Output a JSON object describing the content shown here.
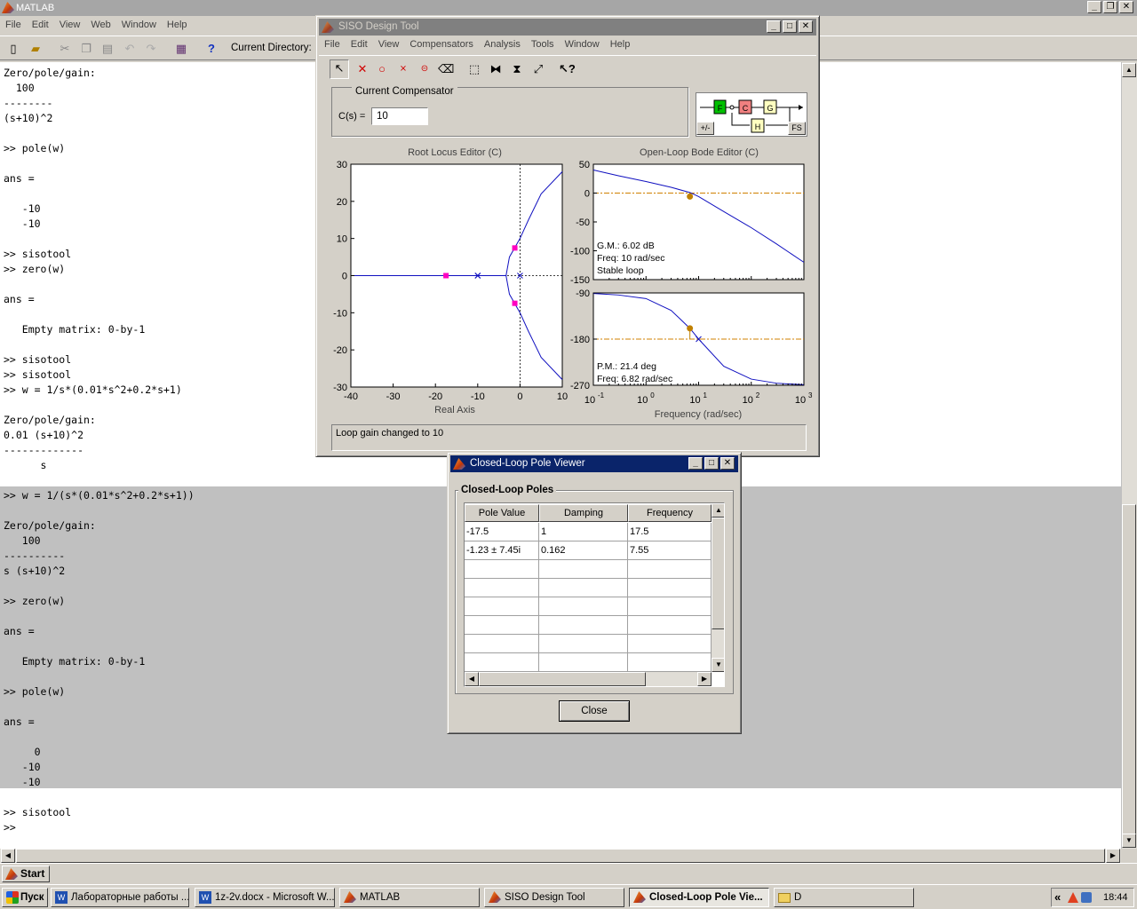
{
  "matlab": {
    "title": "MATLAB",
    "menu": [
      "File",
      "Edit",
      "View",
      "Web",
      "Window",
      "Help"
    ],
    "current_directory_label": "Current Directory:",
    "command_lines": [
      "Zero/pole/gain:",
      "  100",
      "--------",
      "(s+10)^2",
      "",
      ">> pole(w)",
      "",
      "ans =",
      "",
      "   -10",
      "   -10",
      "",
      ">> sisotool",
      ">> zero(w)",
      "",
      "ans =",
      "",
      "   Empty matrix: 0-by-1",
      "",
      ">> sisotool",
      ">> sisotool",
      ">> w = 1/s*(0.01*s^2+0.2*s+1)",
      "",
      "Zero/pole/gain:",
      "0.01 (s+10)^2",
      "-------------",
      "      s",
      "",
      ">> w = 1/(s*(0.01*s^2+0.2*s+1))",
      "",
      "Zero/pole/gain:",
      "   100",
      "----------",
      "s (s+10)^2",
      "",
      ">> zero(w)",
      "",
      "ans =",
      "",
      "   Empty matrix: 0-by-1",
      "",
      ">> pole(w)",
      "",
      "ans =",
      "",
      "     0",
      "   -10",
      "   -10",
      "",
      ">> sisotool",
      ">>"
    ]
  },
  "siso": {
    "title": "SISO Design Tool",
    "menu": [
      "File",
      "Edit",
      "View",
      "Compensators",
      "Analysis",
      "Tools",
      "Window",
      "Help"
    ],
    "compensator_legend": "Current Compensator",
    "cs_label": "C(s) =",
    "cs_value": "10",
    "diagram": {
      "f": "F",
      "c": "C",
      "g": "G",
      "h": "H",
      "pm": "+/-",
      "fs": "FS"
    },
    "root_locus_title": "Root Locus Editor (C)",
    "bode_title": "Open-Loop Bode Editor (C)",
    "rl_xlabel": "Real Axis",
    "bode_xlabel": "Frequency (rad/sec)",
    "gm_text": "G.M.: 6.02 dB",
    "gm_freq": "Freq: 10 rad/sec",
    "stable_text": "Stable loop",
    "pm_text": "P.M.: 21.4 deg",
    "pm_freq": "Freq: 6.82 rad/sec",
    "status": "Loop gain changed to 10"
  },
  "chart_data": [
    {
      "type": "line",
      "title": "Root Locus Editor (C)",
      "xlabel": "Real Axis",
      "ylabel": "",
      "xlim": [
        -40,
        10
      ],
      "ylim": [
        -30,
        30
      ],
      "xticks": [
        -40,
        -30,
        -20,
        -10,
        0,
        10
      ],
      "yticks": [
        30,
        20,
        10,
        0,
        -10,
        -20,
        -30
      ],
      "open_loop_poles": [
        [
          0,
          0
        ],
        [
          -10,
          0
        ],
        [
          -10,
          0
        ]
      ],
      "closed_loop_poles": [
        [
          -17.5,
          0
        ],
        [
          -1.23,
          7.45
        ],
        [
          -1.23,
          -7.45
        ]
      ],
      "branches": [
        {
          "x": [
            -40,
            -10
          ],
          "y": [
            0,
            0
          ]
        },
        {
          "x": [
            -10,
            -3.3,
            -2.5,
            -1,
            0,
            2,
            5,
            10
          ],
          "y": [
            0,
            0,
            5,
            8,
            10,
            15,
            22,
            28
          ]
        },
        {
          "x": [
            -10,
            -3.3,
            -2.5,
            -1,
            0,
            2,
            5,
            10
          ],
          "y": [
            0,
            0,
            -5,
            -8,
            -10,
            -15,
            -22,
            -28
          ]
        }
      ]
    },
    {
      "type": "line",
      "title": "Open-Loop Bode Editor (C)",
      "xlabel": "Frequency (rad/sec)",
      "magnitude": {
        "yticks": [
          50,
          0,
          -50,
          -100,
          -150
        ],
        "ylim": [
          -150,
          50
        ],
        "w": [
          0.1,
          0.3,
          1,
          3,
          6.82,
          10,
          30,
          100,
          300,
          1000
        ],
        "mag_db": [
          40,
          30,
          20,
          10,
          1,
          -6,
          -32,
          -60,
          -88,
          -120
        ]
      },
      "phase": {
        "yticks": [
          -90,
          -180,
          -270
        ],
        "ylim": [
          -270,
          -90
        ],
        "w": [
          0.1,
          0.3,
          1,
          3,
          6.82,
          10,
          30,
          100,
          300,
          1000
        ],
        "phase_deg": [
          -91,
          -94,
          -101,
          -124,
          -159,
          -180,
          -233,
          -258,
          -266,
          -269
        ]
      },
      "xticks": [
        "10^-1",
        "10^0",
        "10^1",
        "10^2",
        "10^3"
      ]
    }
  ],
  "pole_viewer": {
    "title": "Closed-Loop Pole Viewer",
    "group_label": "Closed-Loop Poles",
    "headers": [
      "Pole Value",
      "Damping",
      "Frequency"
    ],
    "rows": [
      [
        "-17.5",
        "1",
        "17.5"
      ],
      [
        "-1.23 ± 7.45i",
        "0.162",
        "7.55"
      ]
    ],
    "close_label": "Close"
  },
  "taskbar": {
    "start_strip": "Start",
    "start_label": "Пуск",
    "items": [
      "Лабораторные работы ...",
      "1z-2v.docx - Microsoft W...",
      "MATLAB",
      "SISO Design Tool",
      "Closed-Loop Pole Vie...",
      "D"
    ],
    "tray_chevron": "«",
    "clock": "18:44"
  }
}
